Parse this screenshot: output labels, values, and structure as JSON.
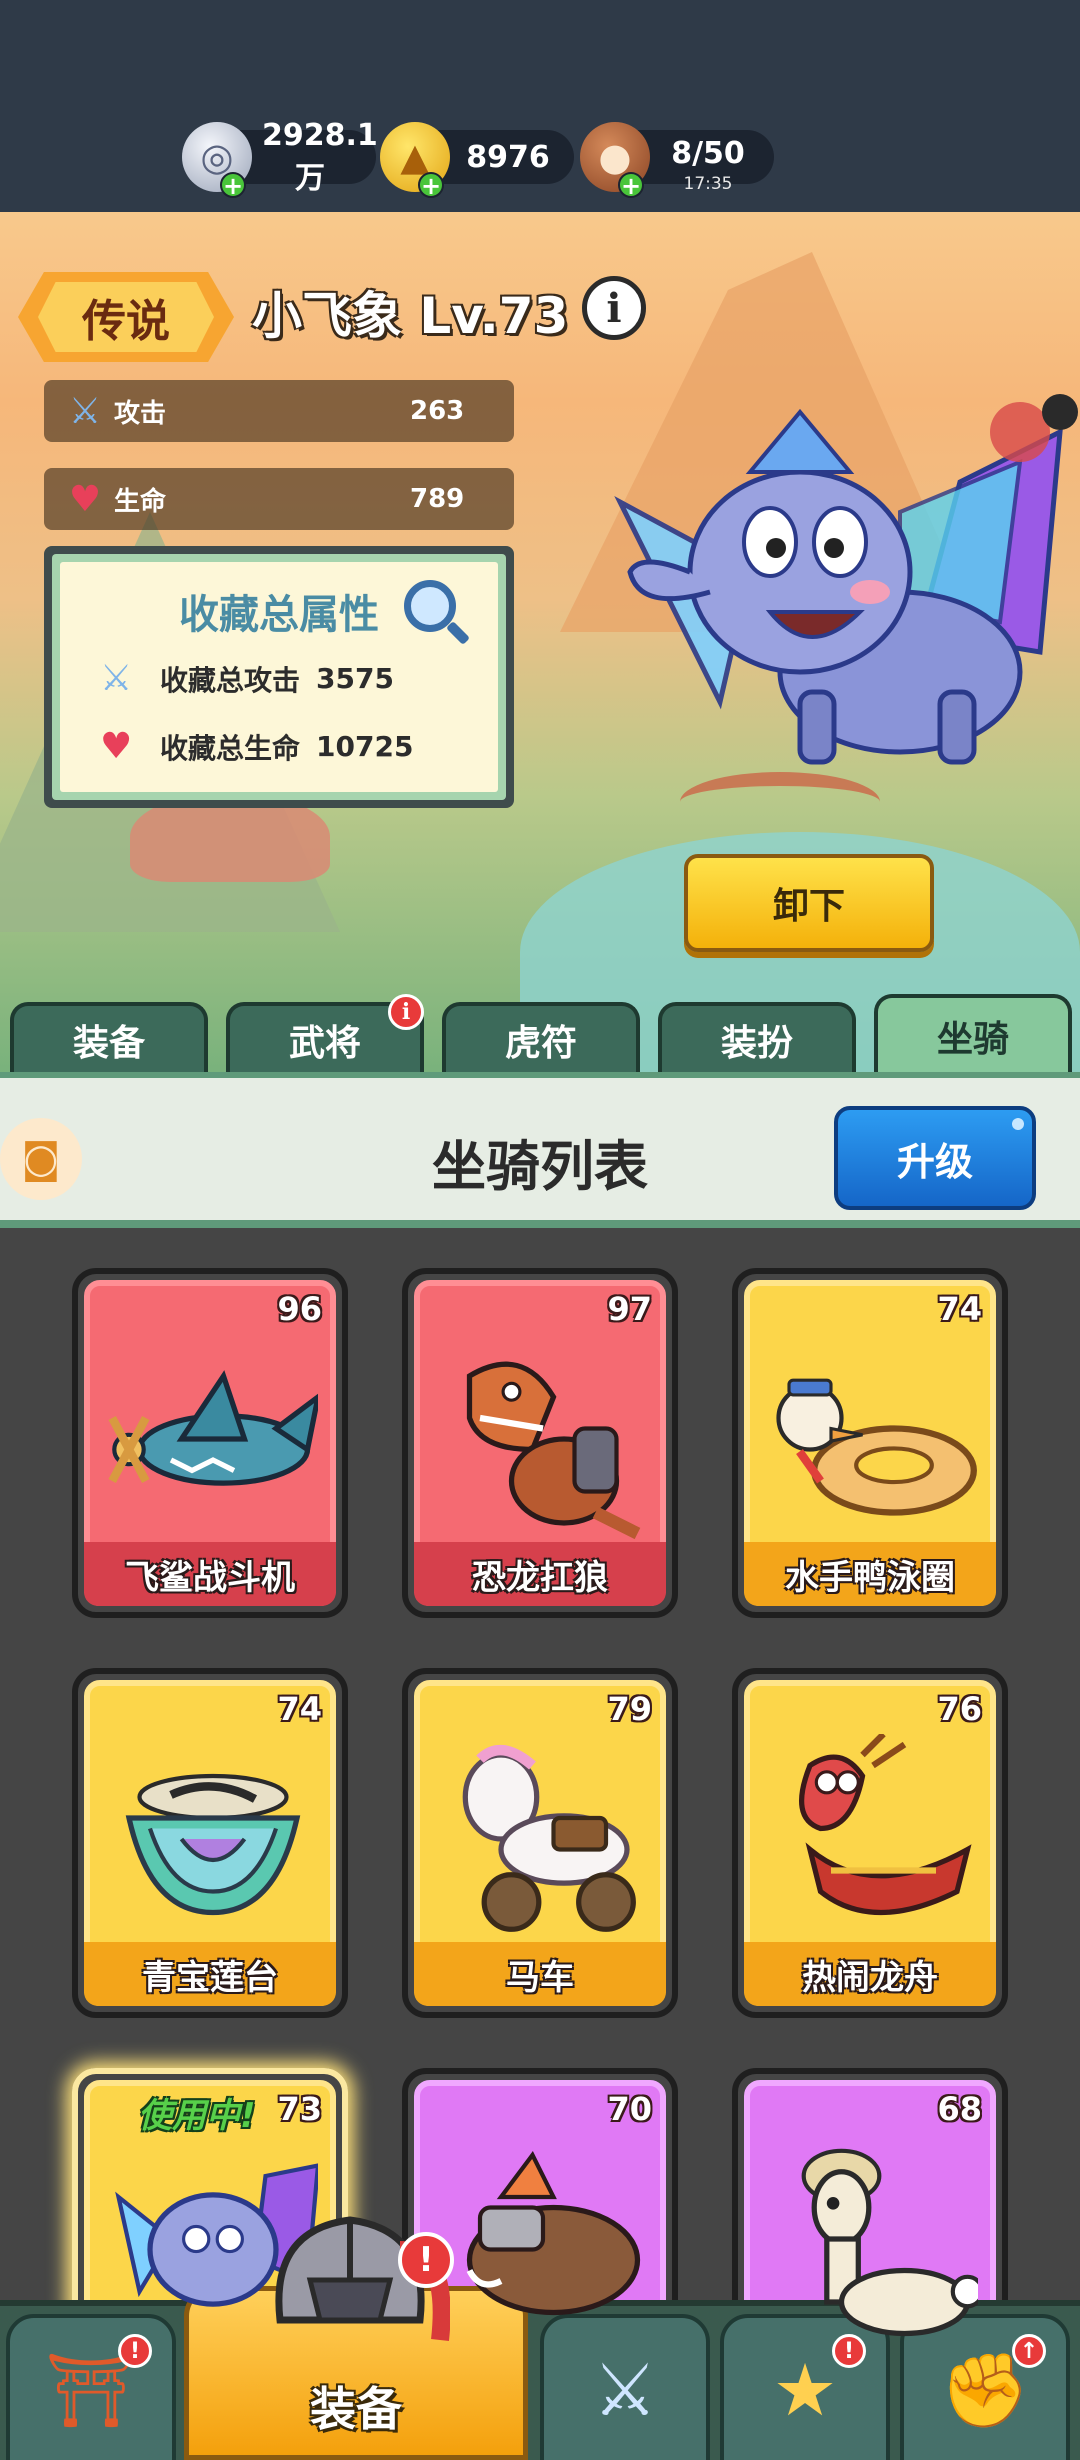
{
  "currency": {
    "silver": "2928.1万",
    "gold": "8976",
    "food": "8/50",
    "food_timer": "17:35"
  },
  "mount": {
    "rarity": "传说",
    "name": "小飞象 Lv.73",
    "attack_label": "攻击",
    "attack_value": "263",
    "hp_label": "生命",
    "hp_value": "789"
  },
  "collection": {
    "title": "收藏总属性",
    "attack_label": "收藏总攻击",
    "attack_value": "3575",
    "hp_label": "收藏总生命",
    "hp_value": "10725"
  },
  "unequip_label": "卸下",
  "tabs": [
    {
      "label": "装备",
      "badge": false
    },
    {
      "label": "武将",
      "badge": true
    },
    {
      "label": "虎符",
      "badge": false
    },
    {
      "label": "装扮",
      "badge": false
    },
    {
      "label": "坐骑",
      "badge": false,
      "active": true
    }
  ],
  "list": {
    "title": "坐骑列表",
    "upgrade_label": "升级"
  },
  "mounts": [
    {
      "name": "飞鲨战斗机",
      "level": "96",
      "rarity": "red"
    },
    {
      "name": "恐龙扛狼",
      "level": "97",
      "rarity": "red"
    },
    {
      "name": "水手鸭泳圈",
      "level": "74",
      "rarity": "yellow"
    },
    {
      "name": "青宝莲台",
      "level": "74",
      "rarity": "yellow"
    },
    {
      "name": "马车",
      "level": "79",
      "rarity": "yellow"
    },
    {
      "name": "热闹龙舟",
      "level": "76",
      "rarity": "yellow"
    },
    {
      "name": "",
      "level": "73",
      "rarity": "yellow",
      "status": "使用中!"
    },
    {
      "name": "",
      "level": "70",
      "rarity": "purple"
    },
    {
      "name": "",
      "level": "68",
      "rarity": "purple"
    }
  ],
  "bottom_nav": {
    "main_label": "装备"
  },
  "colors": {
    "legendary_red": "#f56a72",
    "epic_yellow": "#fcd64a",
    "rare_purple": "#e079f5",
    "primary_blue": "#2d9cf2",
    "accent_gold": "#f4b10a"
  }
}
